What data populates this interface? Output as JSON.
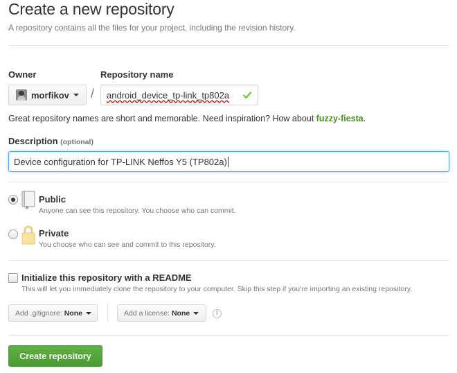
{
  "header": {
    "title": "Create a new repository",
    "subtitle": "A repository contains all the files for your project, including the revision history."
  },
  "owner": {
    "label": "Owner",
    "value": "morfikov"
  },
  "separator": "/",
  "repo_name": {
    "label": "Repository name",
    "value": "android_device_tp-link_tp802a"
  },
  "name_hint": {
    "text": "Great repository names are short and memorable. Need inspiration? How about ",
    "suggestion": "fuzzy-fiesta",
    "suffix": "."
  },
  "description": {
    "label": "Description",
    "optional": "(optional)",
    "value": "Device configuration for TP-LINK Neffos Y5 (TP802a)"
  },
  "visibility": {
    "selected": "public",
    "public": {
      "title": "Public",
      "note": "Anyone can see this repository. You choose who can commit."
    },
    "private": {
      "title": "Private",
      "note": "You choose who can see and commit to this repository."
    }
  },
  "readme": {
    "checked": false,
    "title": "Initialize this repository with a README",
    "note": "This will let you immediately clone the repository to your computer. Skip this step if you’re importing an existing repository."
  },
  "gitignore": {
    "label": "Add .gitignore:",
    "value": "None"
  },
  "license": {
    "label": "Add a license:",
    "value": "None"
  },
  "info_glyph": "i",
  "submit": {
    "label": "Create repository"
  },
  "colors": {
    "accent_green": "#4a8f23",
    "button_green": "#55a532",
    "focus_blue": "#51a7e8",
    "check_green": "#6cc644"
  },
  "icons": {
    "owner_avatar": "avatar",
    "owner_dropdown": "caret-down-icon",
    "name_valid": "check-icon",
    "public": "repo-book-icon",
    "private": "lock-icon",
    "info": "info-icon"
  }
}
